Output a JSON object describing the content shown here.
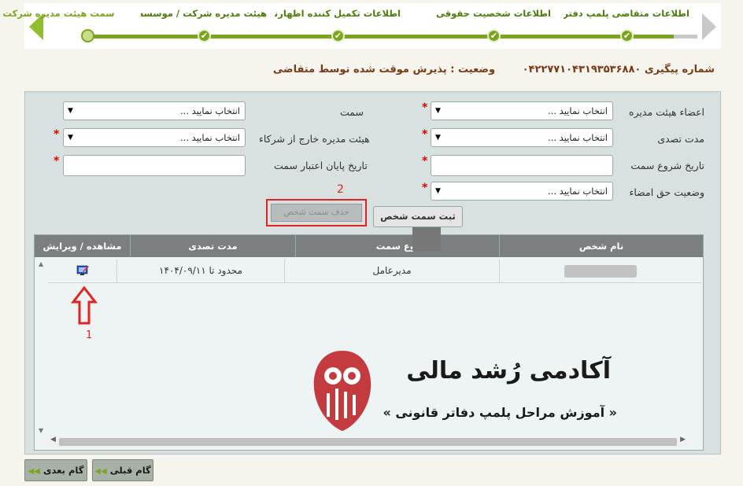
{
  "wizard": {
    "steps": [
      {
        "label": "اطلاعات متقاضی پلمپ دفتر"
      },
      {
        "label": "اطلاعات شخصیت حقوقی"
      },
      {
        "label": "اطلاعات تکمیل کننده اظهارنامه پلمپ"
      },
      {
        "label": "هیئت مدیره شرکت / موسسه"
      },
      {
        "label": "سمت هیئت مدیره شرکت م"
      }
    ],
    "check_glyph": "✔"
  },
  "tracking": {
    "number": "شماره پیگیری ۰۴۲۲۷۷۱۰۴۳۱۹۳۵۳۶۸۸۰",
    "status": "وضعیت : پذیرش موقت شده توسط متقاضی"
  },
  "form": {
    "board_members_label": "اعضاء هیئت مدیره",
    "board_members_value": "انتخاب نمایید ...",
    "position_label": "سمت",
    "position_value": "انتخاب نمایید ...",
    "tenure_label": "مدت تصدی",
    "tenure_value": "انتخاب نمایید ...",
    "external_board_label": "هیئت مدیره خارج از شرکاء",
    "external_board_value": "انتخاب نمایید ...",
    "start_date_label": "تاریخ شروع سمت",
    "start_date_value": "",
    "end_date_label": "تاریخ پایان اعتبار سمت",
    "end_date_value": "",
    "signature_right_label": "وضعیت حق امضاء",
    "signature_right_value": "انتخاب نمایید ...",
    "required_mark": "*",
    "dropdown_glyph": "▼",
    "save_button": "ثبت سمت شخص",
    "delete_button": "حذف سمت شخص"
  },
  "annotations": {
    "marker_1": "1",
    "marker_2": "2"
  },
  "grid": {
    "headers": {
      "name": "نام شخص",
      "position_type": "نوع سمت",
      "tenure": "مدت تصدی",
      "view_edit": "مشاهده / ویرایش"
    },
    "rows": [
      {
        "name": "",
        "position_type": "مدیرعامل",
        "tenure": "محدود تا ۱۴۰۴/۰۹/۱۱"
      }
    ]
  },
  "watermark": {
    "brand": "آکادمی رُشد مالی",
    "subtitle": "« آموزش مراحل پلمپ دفاتر قانونی »"
  },
  "nav": {
    "prev_label": "گام قبلی",
    "next_label": "گام بعدی",
    "prev_arrow": "◀◀",
    "next_arrow": "◀◀"
  },
  "colors": {
    "accent_green": "#7aa51f",
    "annotation_red": "#e02424",
    "grid_header": "#7b7f7f"
  }
}
